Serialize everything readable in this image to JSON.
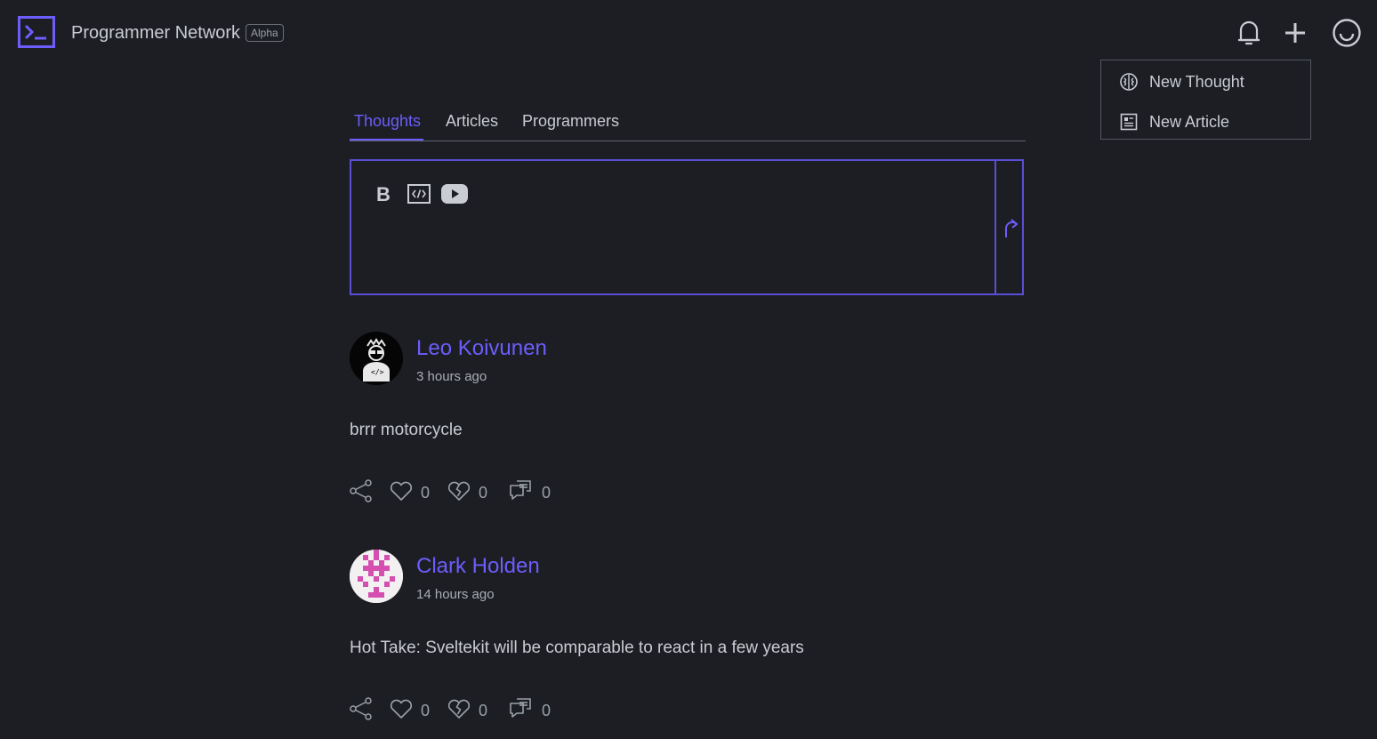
{
  "header": {
    "brand": "Programmer Network",
    "badge": "Alpha",
    "icons": [
      "terminal-logo-icon",
      "bell-icon",
      "plus-icon",
      "smiley-icon"
    ]
  },
  "dropdown": {
    "items": [
      {
        "label": "New Thought",
        "icon": "brain-icon"
      },
      {
        "label": "New Article",
        "icon": "document-icon"
      }
    ]
  },
  "tabs": [
    {
      "label": "Thoughts",
      "active": true
    },
    {
      "label": "Articles",
      "active": false
    },
    {
      "label": "Programmers",
      "active": false
    }
  ],
  "composer": {
    "tools": [
      "bold-icon",
      "code-icon",
      "youtube-icon"
    ],
    "submit_icon": "redo-arrow-icon"
  },
  "posts": [
    {
      "author": "Leo Koivunen",
      "time": "3 hours ago",
      "text": "brrr motorcycle",
      "likes": "0",
      "dislikes": "0",
      "comments": "0"
    },
    {
      "author": "Clark Holden",
      "time": "14 hours ago",
      "text": "Hot Take: Sveltekit will be comparable to react in a few years",
      "likes": "0",
      "dislikes": "0",
      "comments": "0"
    }
  ],
  "colors": {
    "background": "#1c1e23",
    "accent": "#6d5dfc",
    "text": "#c9ccd2",
    "avatar_pattern": "#d44fb0"
  }
}
